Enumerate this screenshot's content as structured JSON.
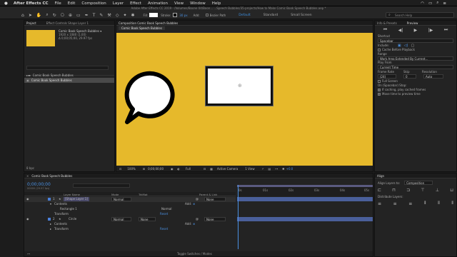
{
  "menubar": {
    "app": "After Effects CC",
    "items": [
      "File",
      "Edit",
      "Composition",
      "Layer",
      "Effect",
      "Animation",
      "View",
      "Window",
      "Help"
    ]
  },
  "window_title": "Adobe After Effects CC 2019 - /Volumes/Boone 04/Boon... ...Speech Bubbles/35-projects/How to Make Comic Book Speech Bubbles.aep *",
  "toolbar": {
    "fill_label": "Fill:",
    "stroke_label": "Stroke:",
    "stroke_px": "30 px",
    "add_label": "Add:",
    "bezier_label": "Bezier Path",
    "workspaces": [
      "Default",
      "Standard",
      "Small Screen"
    ],
    "search_placeholder": "Search Help"
  },
  "project": {
    "tab": "Project",
    "effects_tab": "Effect Controls Shape Layer 1",
    "comp_name": "Comic Book Speech Bubbles ▾",
    "comp_info1": "1920 x 1080 (1.00)",
    "comp_info2": "Δ 0;00;05;00, 29.97 fps",
    "search_placeholder": "",
    "items": [
      "Comic Book Speech Bubbles",
      "Comic Book Speech Bubbles"
    ],
    "footer": "8 bpc"
  },
  "composition": {
    "tab": "Composition Comic Book Speech Bubbles",
    "subtab": "Comic Book Speech Bubbles",
    "bg_color": "#e6b92b",
    "zoom": "100%",
    "timecode": "0;00;00;00",
    "resolution": "Full",
    "camera": "Active Camera",
    "view": "1 View",
    "exposure": "+0.0"
  },
  "preview": {
    "tabs": [
      "Info & Presets",
      "Preview"
    ],
    "shortcut_label": "Shortcut",
    "shortcut": "Spacebar",
    "include_label": "Include:",
    "cache_label": "Cache Before Playback",
    "range_label": "Range",
    "range": "Work Area Extended By Current...",
    "playfrom_label": "Play From",
    "playfrom": "Current Time",
    "framerate_label": "Frame Rate",
    "skip_label": "Skip",
    "resolution_label": "Resolution",
    "framerate": "(24)",
    "skip": "0",
    "resolution": "Auto",
    "fullscreen_label": "Full Screen",
    "onstop_label": "On (Spacebar) Stop:",
    "caching_label": "If caching, play cached frames",
    "movetime_label": "Move time to preview time"
  },
  "timeline": {
    "tab": "Comic Book Speech Bubbles",
    "timecode": "0;00;00;00",
    "fps_info": "00000 (29.97 fps)",
    "headers": [
      "Layer Name",
      "Mode",
      "TrkMat",
      "Parent & Link"
    ],
    "layers": [
      {
        "num": "1",
        "name": "[Shape Layer 1]",
        "mode": "Normal",
        "trk": "",
        "parent": "None"
      },
      {
        "num": "2",
        "name": "Circle",
        "mode": "Normal",
        "trk": "None",
        "parent": "None"
      }
    ],
    "contents": "Contents",
    "add": "Add:",
    "rect": "Rectangle 1",
    "rect_mode": "Normal",
    "transform": "Transform",
    "reset": "Reset",
    "ruler": [
      "0s",
      "01s",
      "02s",
      "03s",
      "04s",
      "05s"
    ],
    "footer": "Toggle Switches / Modes"
  },
  "align": {
    "tab": "Align",
    "align_to_label": "Align Layers to:",
    "align_to": "Composition",
    "distribute_label": "Distribute Layers:"
  }
}
